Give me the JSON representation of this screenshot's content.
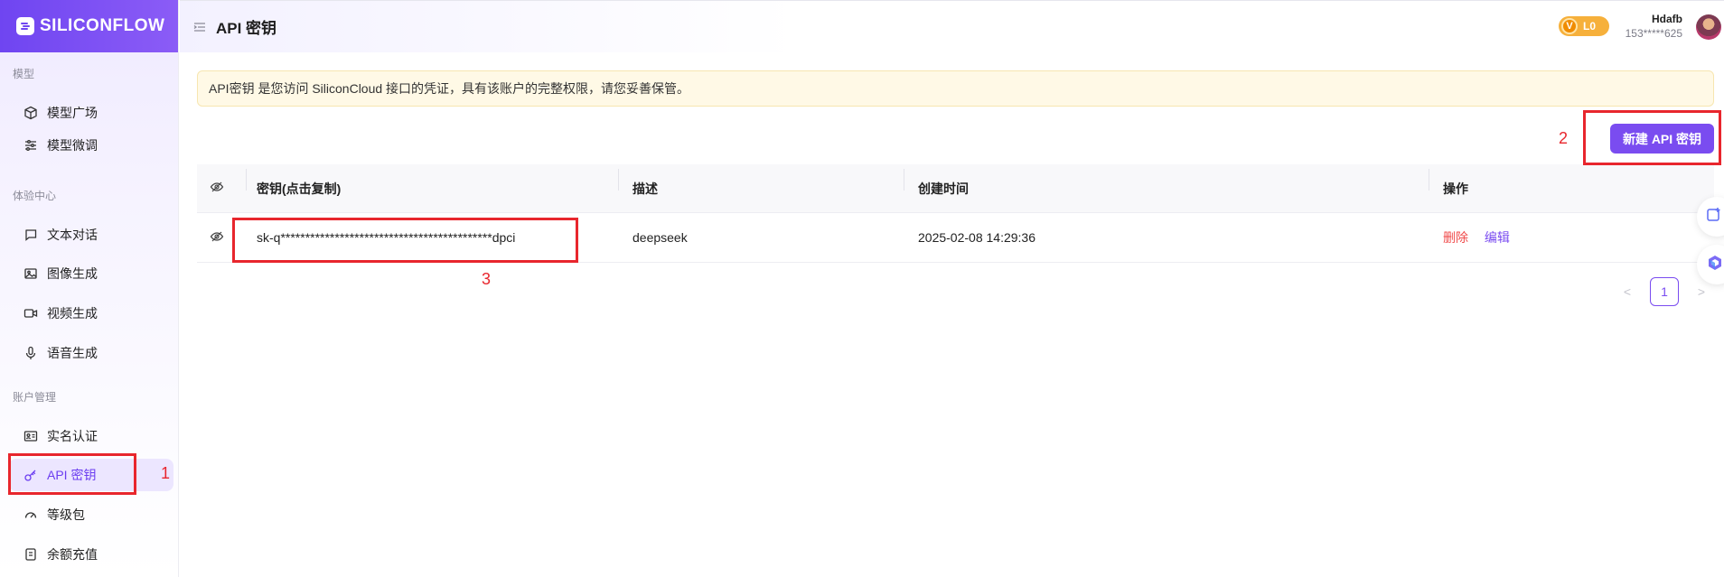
{
  "brand": {
    "name": "SILICONFLOW",
    "logo_color": "#7046f1"
  },
  "sidebar": {
    "sections": [
      {
        "title": "模型",
        "items": [
          {
            "label": "模型广场",
            "icon": "cube-icon"
          },
          {
            "label": "模型微调",
            "icon": "sliders-icon"
          }
        ]
      },
      {
        "title": "体验中心",
        "items": [
          {
            "label": "文本对话",
            "icon": "chat-bubble-icon"
          },
          {
            "label": "图像生成",
            "icon": "image-icon"
          },
          {
            "label": "视频生成",
            "icon": "video-icon"
          },
          {
            "label": "语音生成",
            "icon": "microphone-icon"
          }
        ]
      },
      {
        "title": "账户管理",
        "items": [
          {
            "label": "实名认证",
            "icon": "id-card-icon"
          },
          {
            "label": "API 密钥",
            "icon": "key-icon",
            "active": true
          },
          {
            "label": "等级包",
            "icon": "gauge-icon"
          },
          {
            "label": "余额充值",
            "icon": "wallet-icon"
          }
        ]
      }
    ]
  },
  "header": {
    "title": "API 密钥",
    "level_badge": {
      "icon_letter": "V",
      "label": "L0",
      "color": "#f6b03b"
    },
    "user": {
      "name": "Hdafb",
      "phone": "153*****625"
    }
  },
  "notice": {
    "text": "API密钥 是您访问 SiliconCloud 接口的凭证，具有该账户的完整权限，请您妥善保管。"
  },
  "actions": {
    "new_key_label": "新建 API 密钥",
    "accent": "#7a4cf0"
  },
  "table": {
    "columns": [
      "密钥(点击复制)",
      "描述",
      "创建时间",
      "操作"
    ],
    "rows": [
      {
        "key": "sk-q*******************************************dpci",
        "description": "deepseek",
        "created_at": "2025-02-08 14:29:36",
        "actions": {
          "delete": "删除",
          "edit": "编辑"
        }
      }
    ]
  },
  "pagination": {
    "current_page": "1",
    "prev": "<",
    "next": ">"
  },
  "annotations": {
    "n1": "1",
    "n2": "2",
    "n3": "3"
  }
}
